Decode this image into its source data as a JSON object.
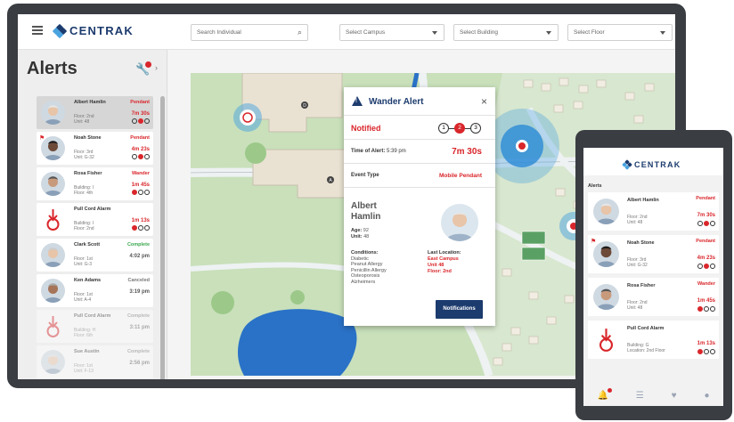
{
  "app": {
    "logo_text": "CENTRAK",
    "search_placeholder": "Search Individual",
    "select_campus": "Select Campus",
    "select_building": "Select Building",
    "select_floor": "Select Floor"
  },
  "sidebar": {
    "title": "Alerts",
    "alerts": [
      {
        "name": "Albert Hamlin",
        "loc1": "Floor: 2nd",
        "loc2": "Unit: 48",
        "status": "Pendant",
        "status_color": "#d9262b",
        "time": "7m 30s",
        "time_color": "#d9262b",
        "steps": [
          false,
          true,
          false
        ]
      },
      {
        "name": "Noah Stone",
        "loc1": "Floor: 3rd",
        "loc2": "Unit: G-32",
        "status": "Pendant",
        "status_color": "#d9262b",
        "time": "4m 23s",
        "time_color": "#d9262b",
        "steps": [
          false,
          true,
          false
        ]
      },
      {
        "name": "Rosa Fisher",
        "loc1": "Building: I",
        "loc2": "Floor: 4th",
        "status": "Wander",
        "status_color": "#d9262b",
        "time": "1m 45s",
        "time_color": "#d9262b",
        "steps": [
          true,
          false,
          false
        ]
      },
      {
        "name": "Pull Cord Alarm",
        "loc1": "Building: I",
        "loc2": "Floor: 2nd",
        "status": "",
        "status_color": "#d9262b",
        "time": "1m 13s",
        "time_color": "#d9262b",
        "steps": [
          true,
          false,
          false
        ]
      },
      {
        "name": "Clark Scott",
        "loc1": "Floor: 1st",
        "loc2": "Unit: G-3",
        "status": "Complete",
        "status_color": "#3aa84f",
        "time": "4:02 pm",
        "time_color": "#555555",
        "steps": []
      },
      {
        "name": "Ken Adams",
        "loc1": "Floor: 1st",
        "loc2": "Unit: A-4",
        "status": "Canceled",
        "status_color": "#777777",
        "time": "3:19 pm",
        "time_color": "#555555",
        "steps": []
      },
      {
        "name": "Pull Cord Alarm",
        "loc1": "Building: H",
        "loc2": "Floor: 6th",
        "status": "Complete",
        "status_color": "#777777",
        "time": "3:11 pm",
        "time_color": "#555555",
        "steps": []
      },
      {
        "name": "Sue Austin",
        "loc1": "Floor: 1st",
        "loc2": "Unit: F-13",
        "status": "Complete",
        "status_color": "#777777",
        "time": "2:56 pm",
        "time_color": "#555555",
        "steps": []
      }
    ]
  },
  "map": {
    "building_labels": [
      "D",
      "A"
    ]
  },
  "popup": {
    "title": "Wander Alert",
    "close": "×",
    "state": "Notified",
    "steps": [
      "1",
      "2",
      "3"
    ],
    "time_label": "Time of Alert:",
    "time_value": "5:39 pm",
    "elapsed": "7m 30s",
    "event_label": "Event Type",
    "event_value": "Mobile Pendant",
    "first_name": "Albert",
    "last_name": "Hamlin",
    "age_label": "Age:",
    "age": "92",
    "unit_label": "Unit:",
    "unit": "48",
    "conditions_label": "Conditions:",
    "conditions": [
      "Diabetic",
      "Peanut Allergy",
      "Penicillin Allergy",
      "Osteoporosis",
      "Alzheimers"
    ],
    "last_location_label": "Last Location:",
    "last_location": [
      "East Campus",
      "Unit 48",
      "Floor: 2nd"
    ],
    "button": "Notifications"
  },
  "phone": {
    "logo_text": "CENTRAK",
    "title": "Alerts",
    "alerts": [
      {
        "name": "Albert Hamlin",
        "loc1": "Floor: 2nd",
        "loc2": "Unit: 48",
        "status": "Pendant",
        "time": "7m 30s"
      },
      {
        "name": "Noah Stone",
        "loc1": "Floor: 3rd",
        "loc2": "Unit: G-32",
        "status": "Pendant",
        "time": "4m 23s"
      },
      {
        "name": "Rosa Fisher",
        "loc1": "Floor: 2nd",
        "loc2": "Unit: 48",
        "status": "Wander",
        "time": "1m 45s"
      },
      {
        "name": "Pull Cord Alarm",
        "loc1": "Building: G",
        "loc2": "Location: 2nd Floor",
        "status": "",
        "time": "1m 13s"
      }
    ]
  },
  "colors": {
    "brand_blue": "#1c3b6e",
    "alert_red": "#d9262b",
    "complete_green": "#3aa84f"
  }
}
